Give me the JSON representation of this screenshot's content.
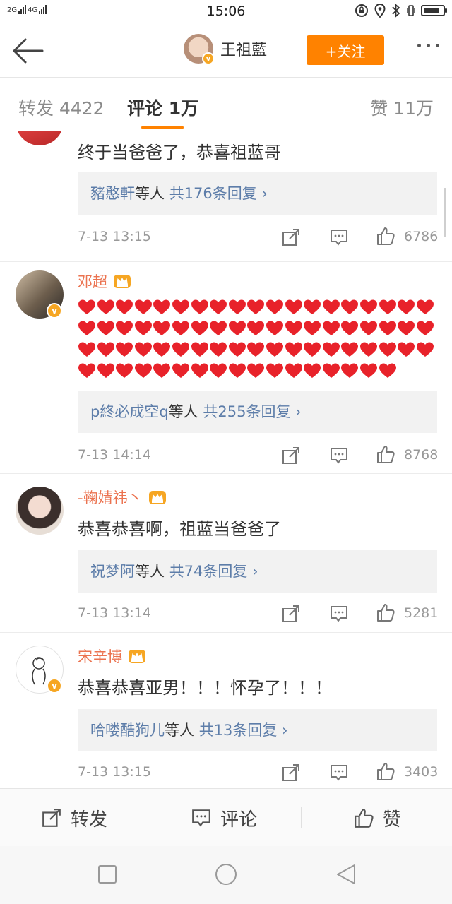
{
  "status_bar": {
    "network_1": "2G",
    "network_2": "4G",
    "time": "15:06"
  },
  "nav": {
    "user_name": "王祖藍",
    "follow_label": "+关注"
  },
  "tabs": [
    {
      "label": "转发 4422"
    },
    {
      "label": "评论 1万"
    },
    {
      "label": "赞 11万"
    }
  ],
  "comments": [
    {
      "text": "终于当爸爸了，恭喜祖蓝哥",
      "reply_names": "豬憨軒",
      "reply_mid": "等人",
      "reply_count": "共176条回复",
      "time": "7-13 13:15",
      "likes": "6786"
    },
    {
      "user": "邓超",
      "heart_count": 74,
      "reply_names": "p終必成空q",
      "reply_mid": "等人",
      "reply_count": "共255条回复",
      "time": "7-13 14:14",
      "likes": "8768"
    },
    {
      "user": "-鞠婧祎丶",
      "text": "恭喜恭喜啊，祖蓝当爸爸了",
      "reply_names": "祝梦阿",
      "reply_mid": "等人",
      "reply_count": "共74条回复",
      "time": "7-13 13:14",
      "likes": "5281"
    },
    {
      "user": "宋辛博",
      "text": "恭喜恭喜亚男！！！怀孕了！！！",
      "reply_names": "哈喽酷狗儿",
      "reply_mid": "等人",
      "reply_count": "共13条回复",
      "time": "7-13 13:15",
      "likes": "3403"
    }
  ],
  "bottom_bar": {
    "repost": "转发",
    "comment": "评论",
    "like": "赞"
  },
  "colors": {
    "accent": "#ff8200",
    "username": "#eb7350",
    "link": "#5d7da9",
    "heart": "#e8222a"
  },
  "icons": [
    "back-arrow-icon",
    "verified-badge-icon",
    "crown-icon",
    "repost-icon",
    "comment-icon",
    "like-icon",
    "heart-icon"
  ]
}
